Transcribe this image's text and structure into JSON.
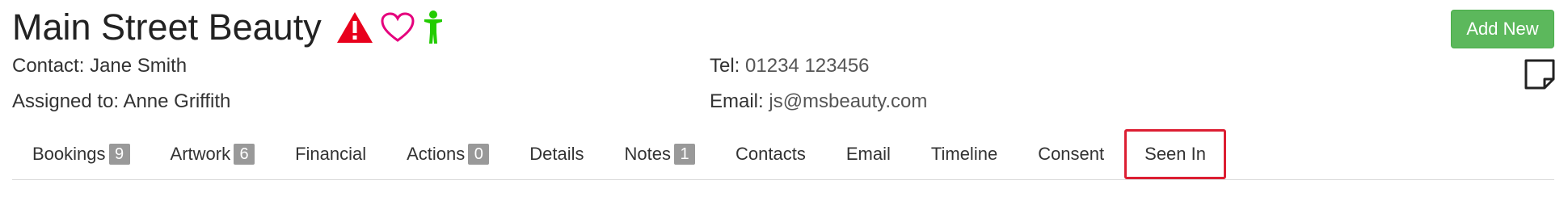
{
  "header": {
    "title": "Main Street Beauty",
    "icons": [
      "warning-icon",
      "heart-icon",
      "person-icon"
    ],
    "add_new_label": "Add New",
    "note_icon": "sticky-note-icon"
  },
  "contact": {
    "contact_label": "Contact:",
    "contact_value": "Jane Smith",
    "assigned_label": "Assigned to:",
    "assigned_value": "Anne Griffith",
    "tel_label": "Tel:",
    "tel_value": "01234 123456",
    "email_label": "Email:",
    "email_value": "js@msbeauty.com"
  },
  "tabs": [
    {
      "label": "Bookings",
      "badge": "9"
    },
    {
      "label": "Artwork",
      "badge": "6"
    },
    {
      "label": "Financial"
    },
    {
      "label": "Actions",
      "badge": "0"
    },
    {
      "label": "Details"
    },
    {
      "label": "Notes",
      "badge": "1"
    },
    {
      "label": "Contacts"
    },
    {
      "label": "Email"
    },
    {
      "label": "Timeline"
    },
    {
      "label": "Consent"
    },
    {
      "label": "Seen In",
      "highlighted": true
    }
  ],
  "colors": {
    "add_new_bg": "#5cb85c",
    "warning": "#e8001c",
    "heart": "#e5007d",
    "person": "#22cc00",
    "highlight_border": "#dc1e32",
    "badge_bg": "#999999"
  }
}
